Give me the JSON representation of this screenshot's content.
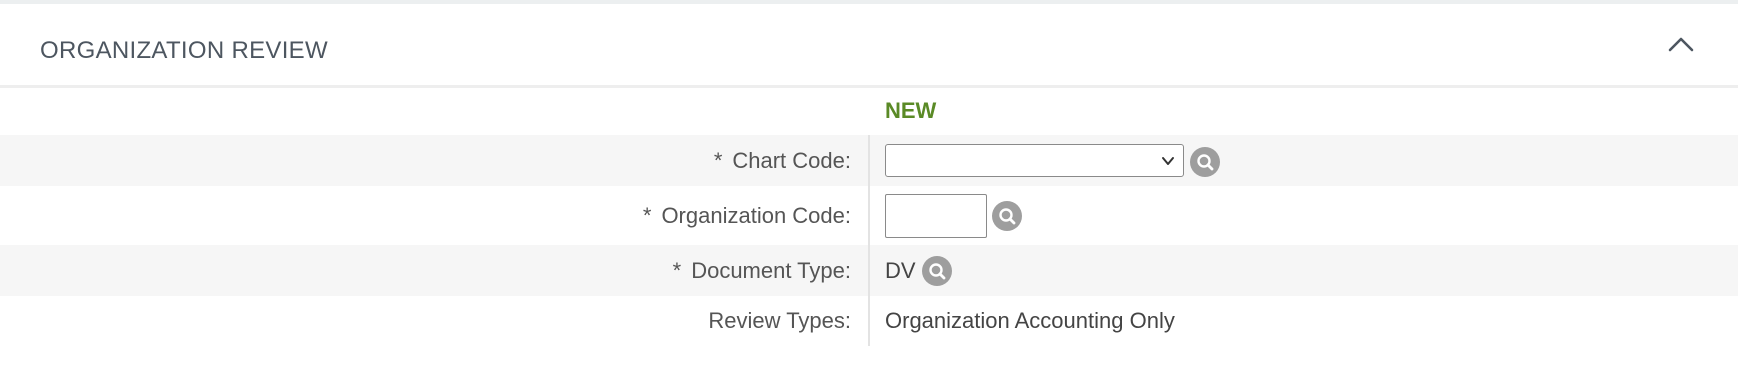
{
  "section": {
    "title": "ORGANIZATION REVIEW",
    "collapse_icon": "chevron-up-icon"
  },
  "status": "NEW",
  "fields": {
    "required_marker": "*",
    "chart_code": {
      "label": "Chart Code:",
      "value": "",
      "lookup_icon": "search-icon"
    },
    "organization_code": {
      "label": "Organization Code:",
      "value": "",
      "lookup_icon": "search-icon"
    },
    "document_type": {
      "label": "Document Type:",
      "value": "DV",
      "lookup_icon": "search-icon"
    },
    "review_types": {
      "label": "Review Types:",
      "value": "Organization Accounting Only"
    }
  },
  "colors": {
    "status_new": "#5a8a26",
    "lookup_button": "#9e9e9e",
    "row_shade": "#f6f6f6"
  }
}
